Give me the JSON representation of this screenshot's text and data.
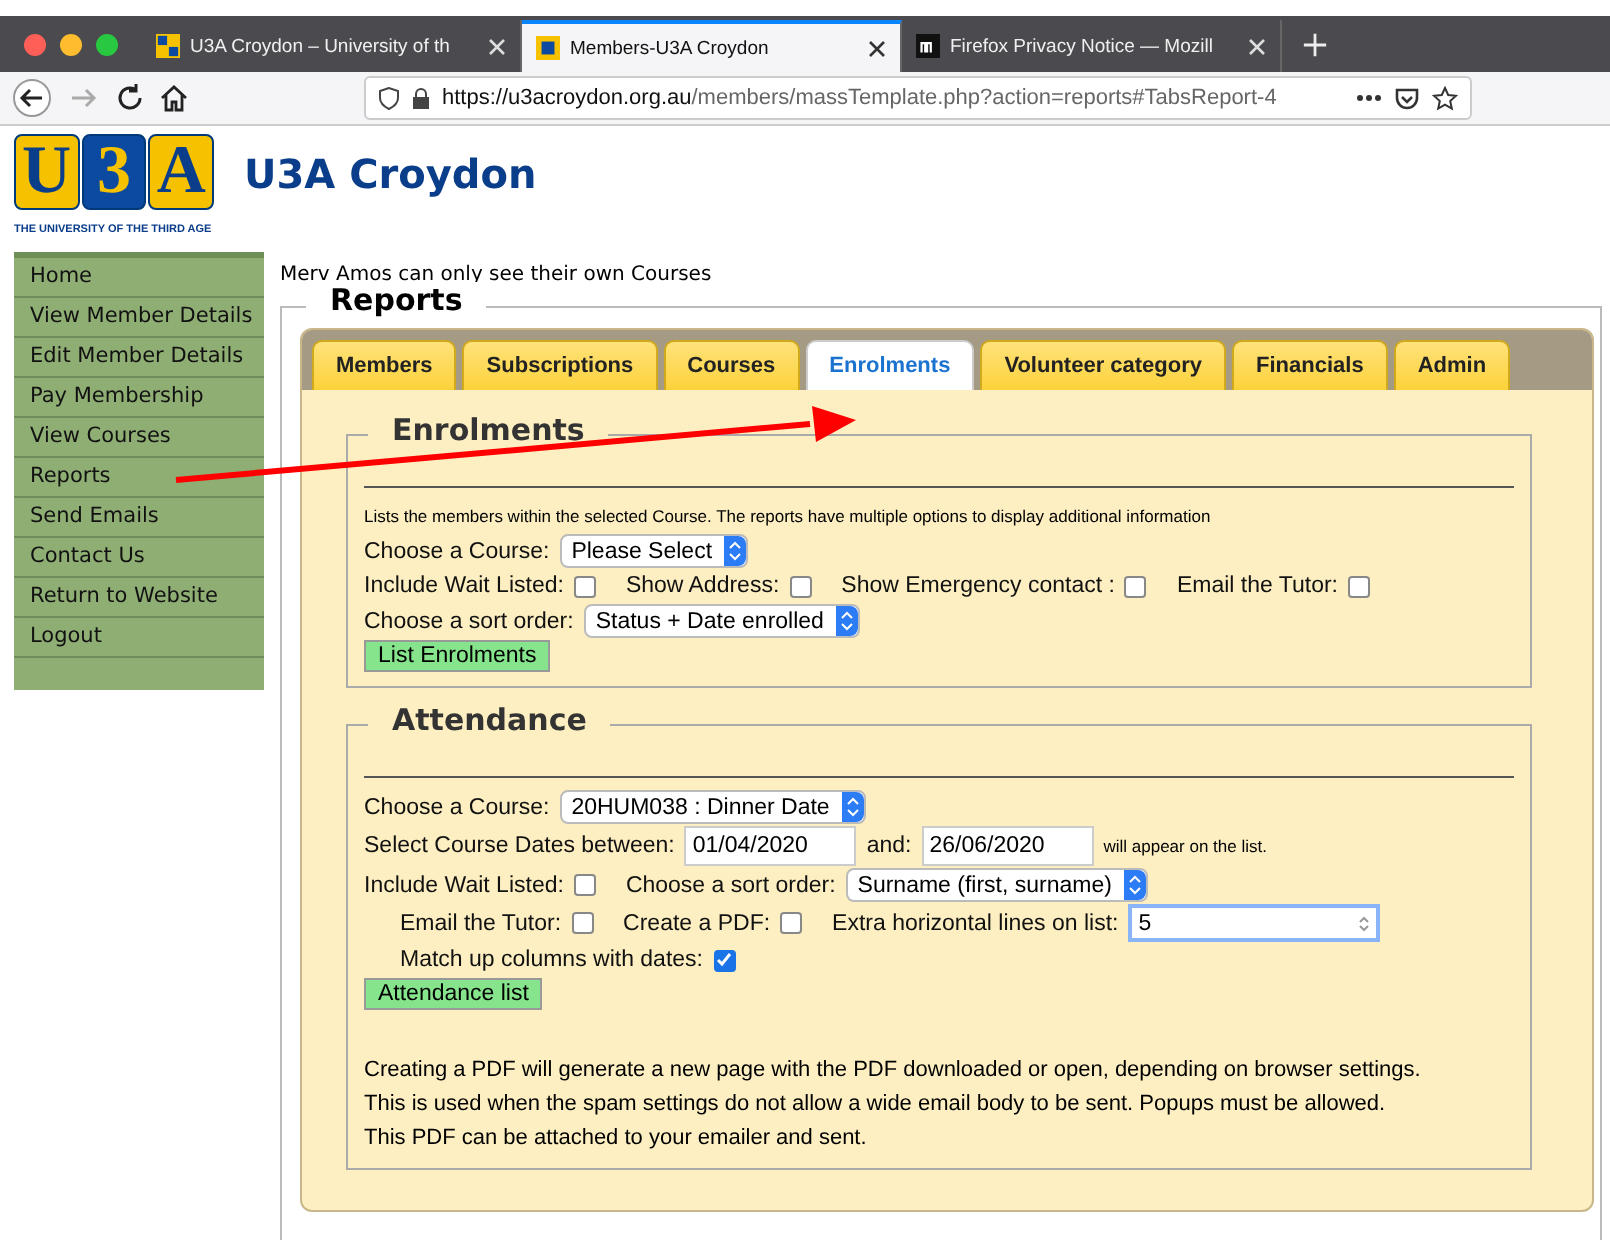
{
  "browser": {
    "tabs": [
      {
        "title": "U3A Croydon – University of th",
        "selected": false
      },
      {
        "title": "Members-U3A Croydon",
        "selected": true
      },
      {
        "title": "Firefox Privacy Notice — Mozill",
        "selected": false
      }
    ],
    "url_host": "https://u3acroydon.org.au",
    "url_path": "/members/massTemplate.php?action=reports#TabsReport-4"
  },
  "header": {
    "logo_letters": [
      "U",
      "3",
      "A"
    ],
    "logo_caption": "THE UNIVERSITY OF THE THIRD AGE",
    "site_title": "U3A Croydon"
  },
  "sidebar": {
    "items": [
      {
        "label": "Home"
      },
      {
        "label": "View Member Details"
      },
      {
        "label": "Edit Member Details"
      },
      {
        "label": "Pay Membership"
      },
      {
        "label": "View Courses"
      },
      {
        "label": "Reports"
      },
      {
        "label": "Send Emails"
      },
      {
        "label": "Contact Us"
      },
      {
        "label": "Return to Website"
      },
      {
        "label": "Logout"
      }
    ]
  },
  "notice": "Merv Amos can only see their own Courses",
  "reports": {
    "title": "Reports",
    "tabs": [
      {
        "label": "Members",
        "selected": false
      },
      {
        "label": "Subscriptions",
        "selected": false
      },
      {
        "label": "Courses",
        "selected": false
      },
      {
        "label": "Enrolments",
        "selected": true
      },
      {
        "label": "Volunteer category",
        "selected": false
      },
      {
        "label": "Financials",
        "selected": false
      },
      {
        "label": "Admin",
        "selected": false
      }
    ],
    "sections": [
      {
        "title": "Enrolments",
        "rows": [
          {
            "kind": "plain",
            "items": [
              {
                "kind": "small",
                "text": "Lists the members within the selected Course. The reports have multiple options to display additional information"
              }
            ]
          },
          {
            "kind": "plain",
            "items": [
              {
                "kind": "label",
                "text": "Choose a Course:"
              },
              {
                "kind": "select",
                "value": "Please Select"
              }
            ]
          },
          {
            "kind": "plain",
            "items": [
              {
                "kind": "label",
                "text": "Include Wait Listed:"
              },
              {
                "kind": "checkbox",
                "checked": false
              },
              {
                "kind": "label",
                "text": "Show Address:"
              },
              {
                "kind": "checkbox",
                "checked": false
              },
              {
                "kind": "label",
                "text": "Show Emergency contact :"
              },
              {
                "kind": "checkbox",
                "checked": false
              },
              {
                "kind": "label",
                "text": "Email the Tutor:"
              },
              {
                "kind": "checkbox",
                "checked": false
              }
            ]
          },
          {
            "kind": "plain",
            "items": [
              {
                "kind": "label",
                "text": "Choose a sort order:"
              },
              {
                "kind": "select",
                "value": "Status + Date enrolled"
              }
            ]
          },
          {
            "kind": "plain",
            "items": [
              {
                "kind": "button",
                "label": "List Enrolments"
              }
            ]
          }
        ]
      },
      {
        "title": "Attendance",
        "rows": [
          {
            "kind": "plain",
            "items": [
              {
                "kind": "label",
                "text": "Choose a Course:"
              },
              {
                "kind": "select",
                "value": "20HUM038 : Dinner Date"
              }
            ]
          },
          {
            "kind": "plain",
            "items": [
              {
                "kind": "label",
                "text": "Select Course Dates between:"
              },
              {
                "kind": "input",
                "value": "01/04/2020"
              },
              {
                "kind": "label",
                "text": "and:"
              },
              {
                "kind": "input",
                "value": "26/06/2020"
              },
              {
                "kind": "small",
                "text": "will appear on the list."
              }
            ]
          },
          {
            "kind": "plain",
            "items": [
              {
                "kind": "label",
                "text": "Include Wait Listed:"
              },
              {
                "kind": "checkbox",
                "checked": false
              },
              {
                "kind": "label",
                "text": "Choose a sort order:"
              },
              {
                "kind": "select",
                "value": "Surname (first, surname)"
              }
            ]
          },
          {
            "kind": "indented",
            "items": [
              {
                "kind": "label",
                "text": "Email the Tutor:"
              },
              {
                "kind": "checkbox",
                "checked": false
              },
              {
                "kind": "label",
                "text": "Create a PDF:"
              },
              {
                "kind": "checkbox",
                "checked": false
              },
              {
                "kind": "label",
                "text": "Extra horizontal lines on list:"
              },
              {
                "kind": "number",
                "value": "5"
              }
            ]
          },
          {
            "kind": "indented",
            "items": [
              {
                "kind": "label",
                "text": "Match up columns with dates:"
              },
              {
                "kind": "checkbox",
                "checked": true
              }
            ]
          },
          {
            "kind": "plain",
            "items": [
              {
                "kind": "button",
                "label": "Attendance list"
              }
            ]
          },
          {
            "kind": "gap",
            "items": []
          },
          {
            "kind": "plain",
            "items": [
              {
                "kind": "para",
                "text": "Creating a PDF will generate a new page with the PDF downloaded or open, depending on browser settings."
              }
            ]
          },
          {
            "kind": "plain",
            "items": [
              {
                "kind": "para",
                "text": "This is used when the spam settings do not allow a wide email body to be sent. Popups must be allowed."
              }
            ]
          },
          {
            "kind": "plain",
            "items": [
              {
                "kind": "para",
                "text": "This PDF can be attached to your emailer and sent."
              }
            ]
          }
        ]
      }
    ]
  }
}
